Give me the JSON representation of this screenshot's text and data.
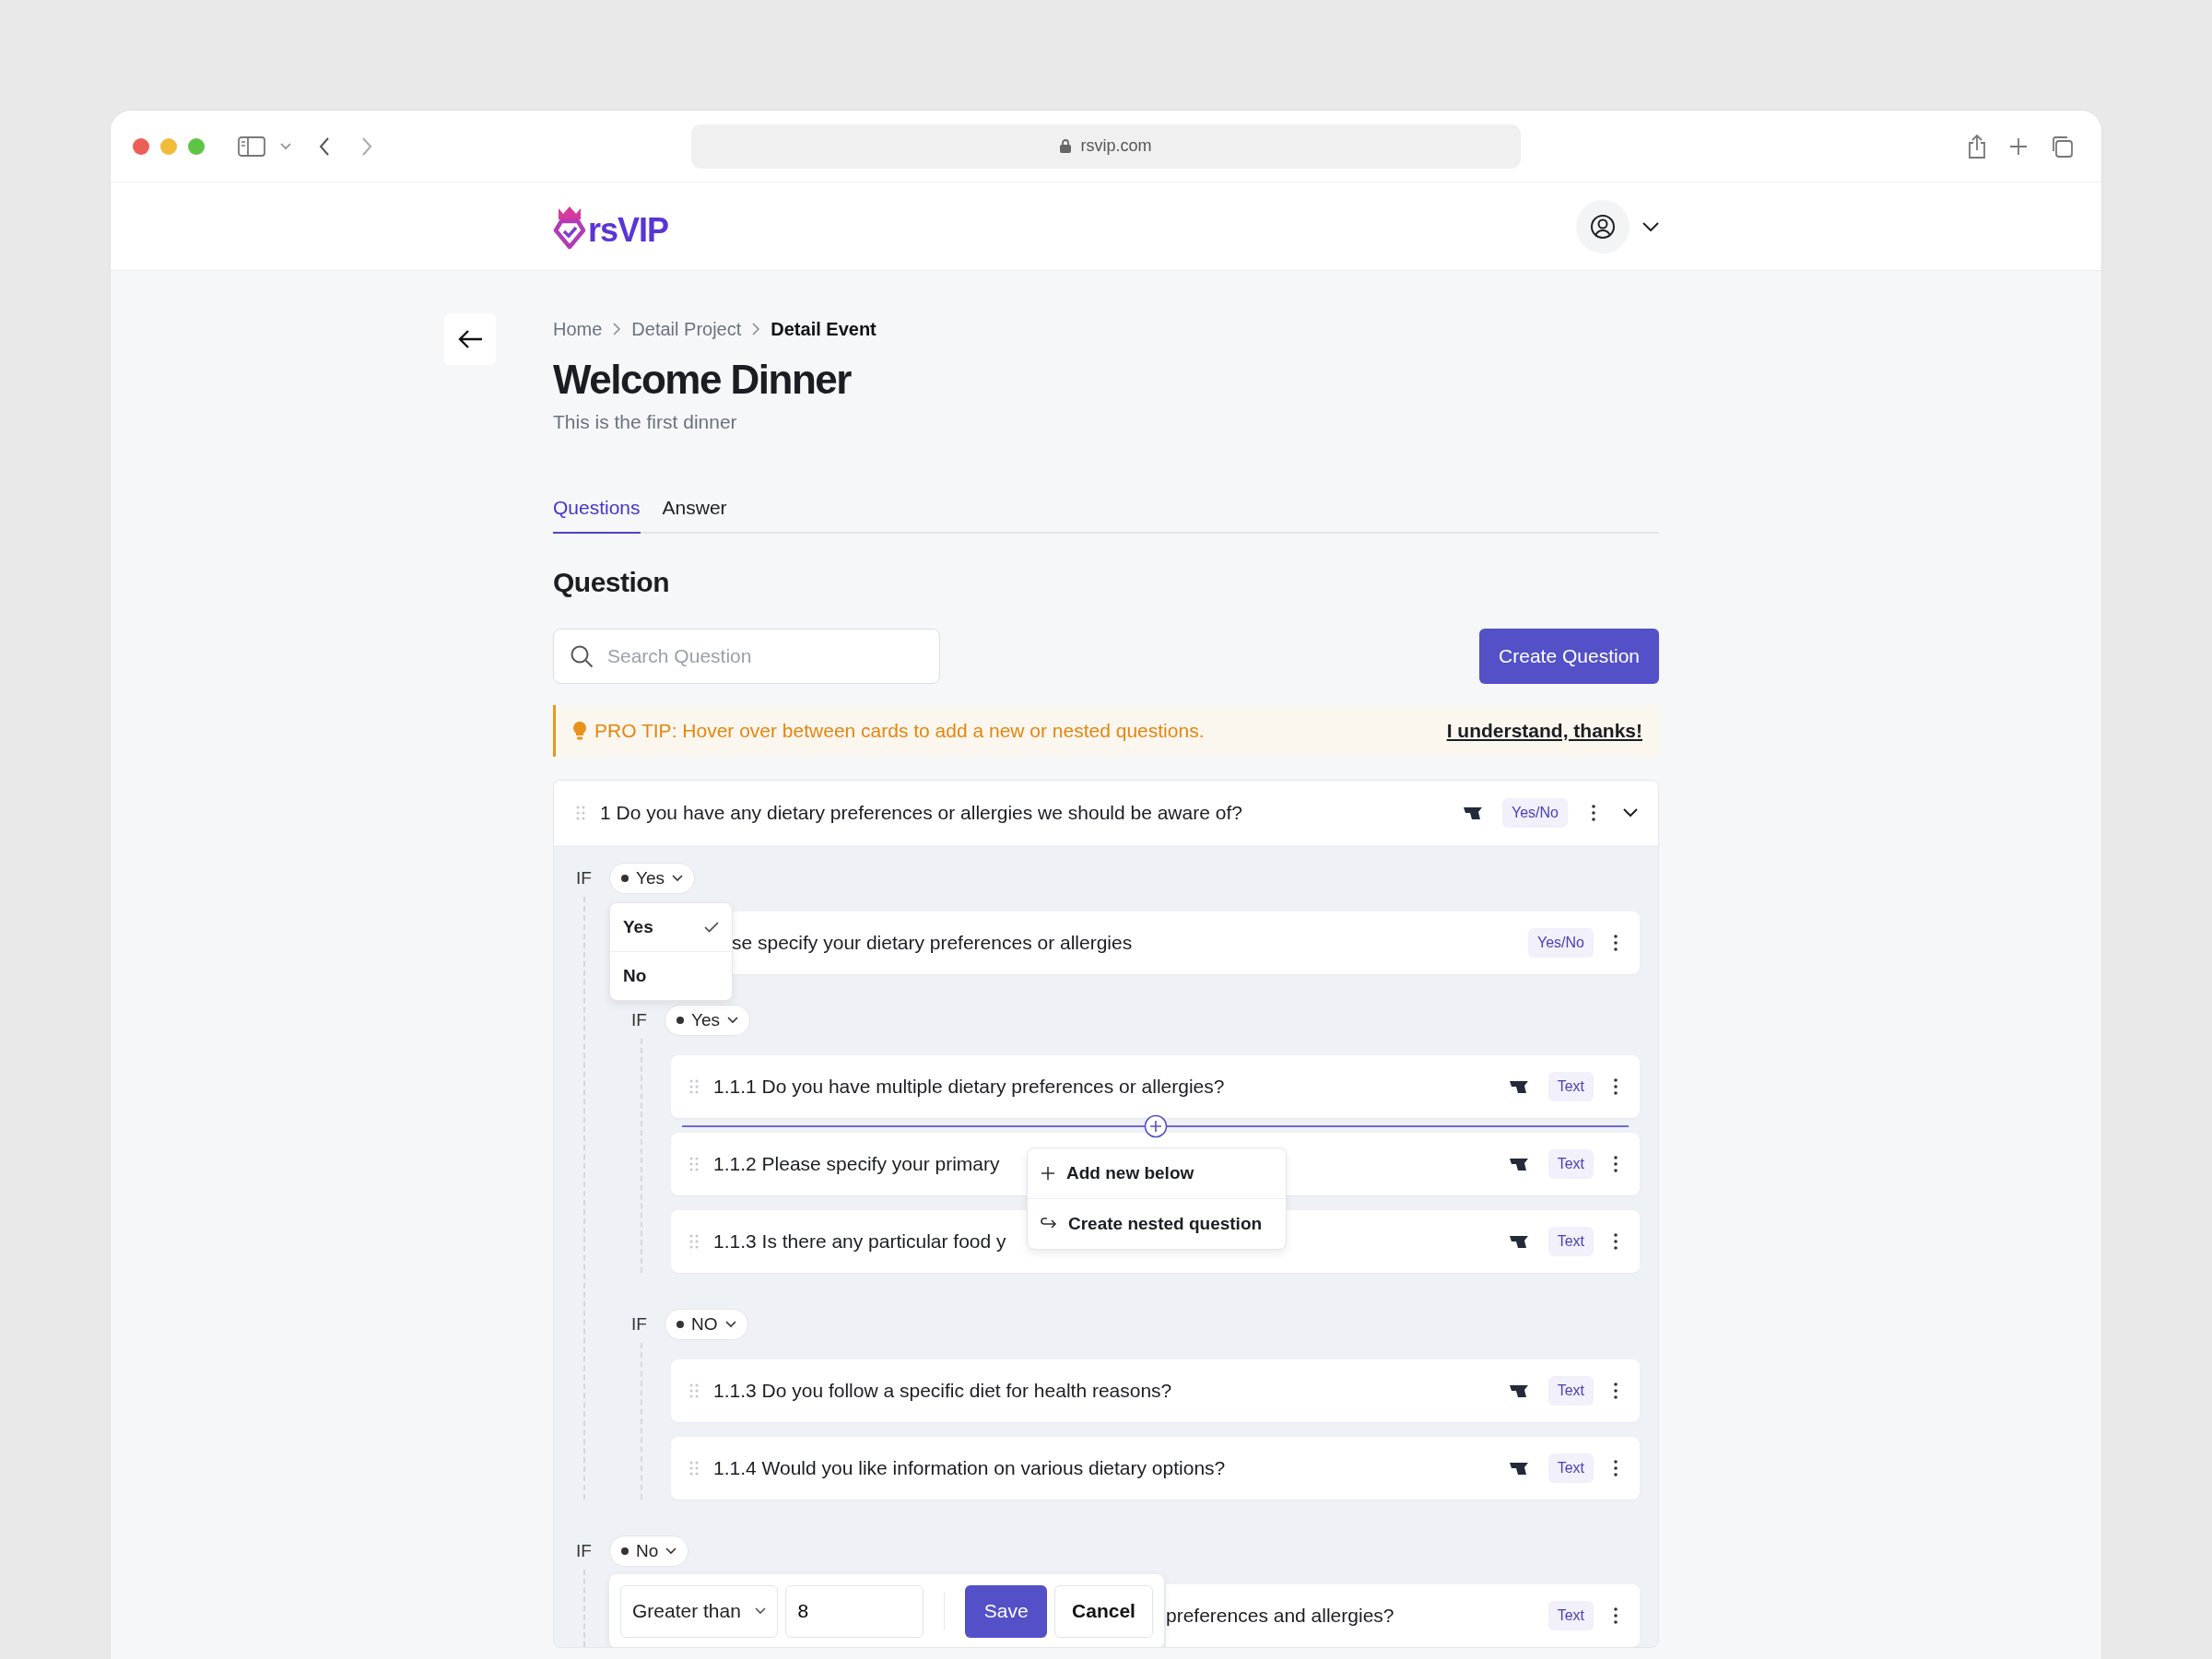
{
  "browser": {
    "url": "rsvip.com"
  },
  "header": {
    "logo": "rsVIP"
  },
  "breadcrumb": [
    {
      "label": "Home"
    },
    {
      "label": "Detail Project"
    },
    {
      "label": "Detail Event"
    }
  ],
  "title": "Welcome Dinner",
  "subtitle": "This is the first dinner",
  "tabs": [
    {
      "label": "Questions",
      "selected": true
    },
    {
      "label": "Answer",
      "selected": false
    }
  ],
  "section_title": "Question",
  "search": {
    "placeholder": "Search Question"
  },
  "create_button": "Create Question",
  "tip": {
    "text": "PRO TIP: Hover over between cards to add a new or nested questions.",
    "dismiss": "I understand, thanks!"
  },
  "question": {
    "text": "1 Do you have any dietary preferences or allergies we should be aware of?",
    "type": "Yes/No",
    "flagged": true,
    "expanded": true,
    "branches": [
      {
        "if": "IF",
        "condition": "Yes",
        "menu": [
          {
            "label": "Yes",
            "selected": true
          },
          {
            "label": "No",
            "selected": false
          }
        ],
        "questions": [
          {
            "text": "se specify your dietary preferences or allergies",
            "type": "Yes/No",
            "flagged": false,
            "partly_hidden": true,
            "branches": [
              {
                "if": "IF",
                "condition": "Yes",
                "questions": [
                  {
                    "text": "1.1.1 Do you have multiple dietary preferences or allergies?",
                    "type": "Text",
                    "flagged": true,
                    "partly_hidden": false,
                    "insert_below": true
                  },
                  {
                    "text": "1.1.2 Please specify your primary",
                    "type": "Text",
                    "flagged": true,
                    "partly_hidden": false
                  },
                  {
                    "text": "1.1.3 Is there any particular food y",
                    "type": "Text",
                    "flagged": true,
                    "partly_hidden": false
                  }
                ]
              },
              {
                "if": "IF",
                "condition": "NO",
                "questions": [
                  {
                    "text": "1.1.3 Do you follow a specific diet for health reasons?",
                    "type": "Text",
                    "flagged": true,
                    "partly_hidden": false
                  },
                  {
                    "text": "1.1.4 Would you like information on various dietary options?",
                    "type": "Text",
                    "flagged": true,
                    "partly_hidden": false
                  }
                ]
              }
            ]
          }
        ]
      },
      {
        "if": "IF",
        "condition": "No",
        "editor": {
          "operator": "Greater than",
          "value": "8",
          "save": "Save",
          "cancel": "Cancel"
        },
        "questions": [
          {
            "text": "preferences and allergies?",
            "type": "Text",
            "flagged": false,
            "partly_hidden": true
          }
        ]
      }
    ]
  },
  "insert_menu": [
    {
      "label": "Add new below",
      "kind": "add"
    },
    {
      "label": "Create nested question",
      "kind": "nested"
    }
  ]
}
